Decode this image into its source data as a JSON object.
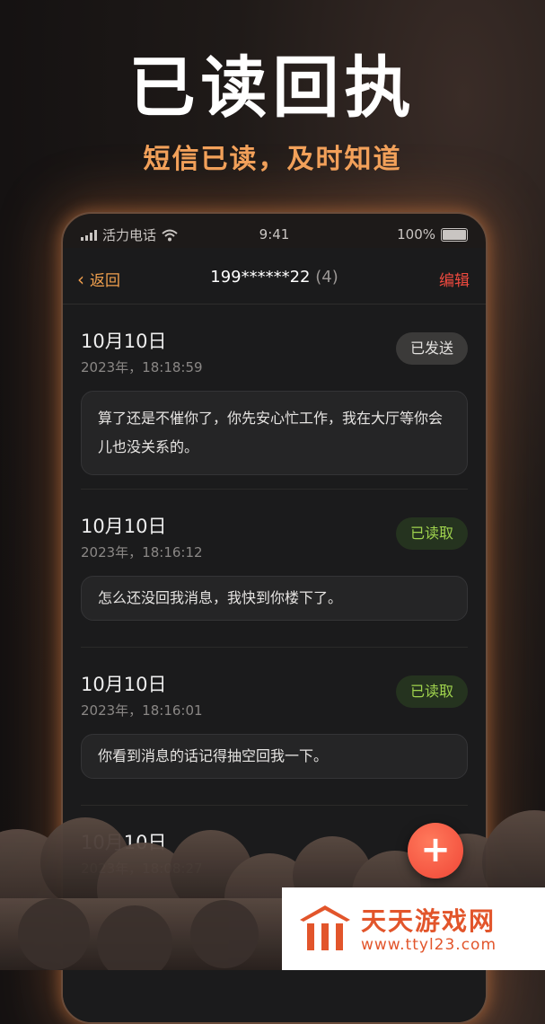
{
  "hero": {
    "title": "已读回执",
    "subtitle": "短信已读，及时知道"
  },
  "status_bar": {
    "carrier": "活力电话",
    "time": "9:41",
    "battery": "100%"
  },
  "nav": {
    "back": "返回",
    "title": "199******22",
    "count": "(4)",
    "edit": "编辑"
  },
  "messages": [
    {
      "date": "10月10日",
      "time": "2023年，18:18:59",
      "status": "已发送",
      "status_kind": "sent",
      "text": "算了还是不催你了，你先安心忙工作，我在大厅等你会儿也没关系的。"
    },
    {
      "date": "10月10日",
      "time": "2023年，18:16:12",
      "status": "已读取",
      "status_kind": "read",
      "text": "怎么还没回我消息，我快到你楼下了。"
    },
    {
      "date": "10月10日",
      "time": "2023年，18:16:01",
      "status": "已读取",
      "status_kind": "read",
      "text": "你看到消息的话记得抽空回我一下。"
    },
    {
      "date": "10月10日",
      "time": "2023年，18:08:27"
    }
  ],
  "fab": {
    "icon": "plus-icon",
    "label": "+"
  },
  "watermark": {
    "name": "天天游戏网",
    "url": "www.ttyl23.com"
  },
  "colors": {
    "accent": "#f1a04e",
    "edit": "#ef4a3f",
    "read": "#9fd24d",
    "fab": "#f04636"
  }
}
